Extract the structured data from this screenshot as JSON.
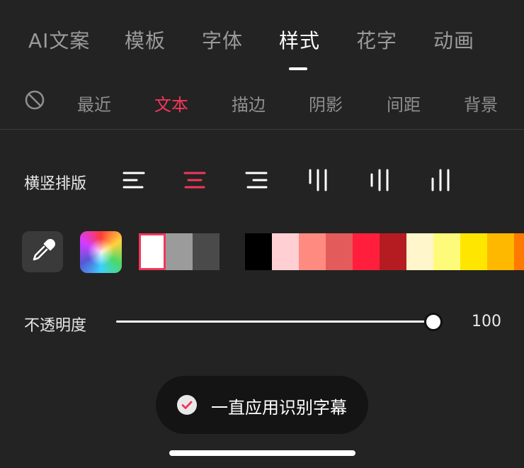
{
  "top_tabs": [
    {
      "label": "AI文案"
    },
    {
      "label": "模板"
    },
    {
      "label": "字体"
    },
    {
      "label": "样式"
    },
    {
      "label": "花字"
    },
    {
      "label": "动画"
    }
  ],
  "active_top_tab": "样式",
  "sub_tabs": [
    {
      "label": "最近"
    },
    {
      "label": "文本"
    },
    {
      "label": "描边"
    },
    {
      "label": "阴影"
    },
    {
      "label": "间距"
    },
    {
      "label": "背景"
    }
  ],
  "active_sub_tab": "文本",
  "layout_row": {
    "label": "横竖排版",
    "options": [
      "align-left-icon",
      "align-center-icon",
      "align-right-icon",
      "vertical-top-icon",
      "vertical-center-icon",
      "vertical-bottom-icon"
    ],
    "selected": "align-center-icon"
  },
  "colors": {
    "accent": "#f2375a",
    "selected_swatch": "#ffffff",
    "swatches_group1": [
      "#ffffff",
      "#9b9b9b",
      "#4a4a4a"
    ],
    "swatches_group2": [
      "#000000",
      "#ffcfd4",
      "#ff8a80",
      "#e35b5b",
      "#ff1f3d",
      "#b51c22",
      "#fff6cc",
      "#fffb7a",
      "#ffe600",
      "#ffb800",
      "#ff7a00"
    ]
  },
  "opacity": {
    "label": "不透明度",
    "value": "100"
  },
  "apply_subtitles": {
    "label": "一直应用识别字幕",
    "checked": true
  }
}
